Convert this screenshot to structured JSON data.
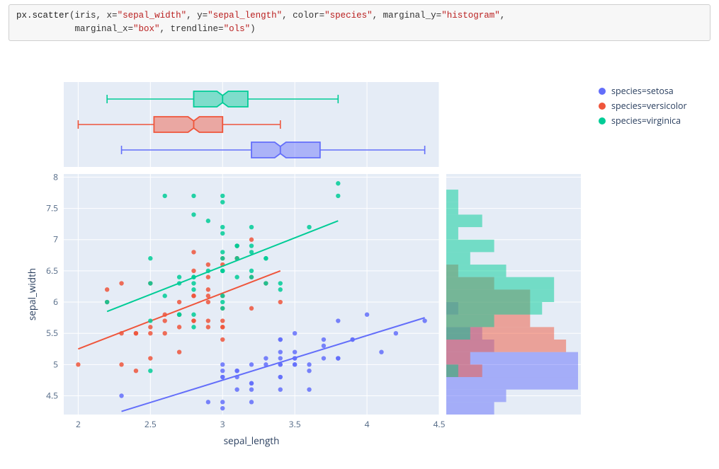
{
  "code_cell": {
    "tokens": [
      {
        "t": "px",
        "cls": "code-var"
      },
      {
        "t": ".",
        "cls": ""
      },
      {
        "t": "scatter",
        "cls": "code-fn"
      },
      {
        "t": "(iris, x=",
        "cls": ""
      },
      {
        "t": "\"sepal_width\"",
        "cls": "code-str"
      },
      {
        "t": ", y=",
        "cls": ""
      },
      {
        "t": "\"sepal_length\"",
        "cls": "code-str"
      },
      {
        "t": ", color=",
        "cls": ""
      },
      {
        "t": "\"species\"",
        "cls": "code-str"
      },
      {
        "t": ", marginal_y=",
        "cls": ""
      },
      {
        "t": "\"histogram\"",
        "cls": "code-str"
      },
      {
        "t": ",",
        "cls": ""
      },
      {
        "t": "\n           marginal_x=",
        "cls": ""
      },
      {
        "t": "\"box\"",
        "cls": "code-str"
      },
      {
        "t": ", trendline=",
        "cls": ""
      },
      {
        "t": "\"ols\"",
        "cls": "code-str"
      },
      {
        "t": ")",
        "cls": ""
      }
    ]
  },
  "legend": {
    "items": [
      {
        "label": "species=setosa",
        "color": "#636efa"
      },
      {
        "label": "species=versicolor",
        "color": "#ef553b"
      },
      {
        "label": "species=virginica",
        "color": "#00cc96"
      }
    ]
  },
  "axes": {
    "x_title": "sepal_length",
    "y_title": "sepal_width",
    "x_ticks": [
      2,
      2.5,
      3,
      3.5,
      4,
      4.5
    ],
    "y_ticks": [
      4.5,
      5,
      5.5,
      6,
      6.5,
      7,
      7.5,
      8
    ],
    "x_range": [
      1.9,
      4.5
    ],
    "y_range": [
      4.2,
      8.05
    ]
  },
  "colors": {
    "setosa": "#636efa",
    "versicolor": "#ef553b",
    "virginica": "#00cc96"
  },
  "chart_data": {
    "type": "scatter",
    "title": "",
    "xlabel": "sepal_length",
    "ylabel": "sepal_width",
    "xlim": [
      1.9,
      4.5
    ],
    "ylim": [
      4.2,
      8.05
    ],
    "marginal_x": "box",
    "marginal_y": "histogram",
    "series": [
      {
        "name": "setosa",
        "color": "#636efa",
        "points": [
          [
            3.5,
            5.1
          ],
          [
            3.0,
            4.9
          ],
          [
            3.2,
            4.7
          ],
          [
            3.1,
            4.6
          ],
          [
            3.6,
            5.0
          ],
          [
            3.9,
            5.4
          ],
          [
            3.4,
            4.6
          ],
          [
            3.4,
            5.0
          ],
          [
            2.9,
            4.4
          ],
          [
            3.1,
            4.9
          ],
          [
            3.7,
            5.4
          ],
          [
            3.4,
            4.8
          ],
          [
            3.0,
            4.8
          ],
          [
            3.0,
            4.3
          ],
          [
            4.0,
            5.8
          ],
          [
            4.4,
            5.7
          ],
          [
            3.9,
            5.4
          ],
          [
            3.5,
            5.1
          ],
          [
            3.8,
            5.7
          ],
          [
            3.8,
            5.1
          ],
          [
            3.4,
            5.4
          ],
          [
            3.7,
            5.1
          ],
          [
            3.6,
            4.6
          ],
          [
            3.3,
            5.1
          ],
          [
            3.4,
            4.8
          ],
          [
            3.0,
            5.0
          ],
          [
            3.4,
            5.0
          ],
          [
            3.5,
            5.2
          ],
          [
            3.4,
            5.2
          ],
          [
            3.2,
            4.7
          ],
          [
            3.1,
            4.8
          ],
          [
            3.4,
            5.4
          ],
          [
            4.1,
            5.2
          ],
          [
            4.2,
            5.5
          ],
          [
            3.1,
            4.9
          ],
          [
            3.2,
            5.0
          ],
          [
            3.5,
            5.5
          ],
          [
            3.6,
            4.9
          ],
          [
            3.0,
            4.4
          ],
          [
            3.4,
            5.1
          ],
          [
            3.5,
            5.0
          ],
          [
            2.3,
            4.5
          ],
          [
            3.2,
            4.4
          ],
          [
            3.5,
            5.0
          ],
          [
            3.8,
            5.1
          ],
          [
            3.0,
            4.8
          ],
          [
            3.8,
            5.1
          ],
          [
            3.2,
            4.6
          ],
          [
            3.7,
            5.3
          ],
          [
            3.3,
            5.0
          ]
        ],
        "trendline": {
          "x1": 2.3,
          "y1": 4.25,
          "x2": 4.4,
          "y2": 5.75
        },
        "box": {
          "min": 2.3,
          "q1": 3.2,
          "median": 3.4,
          "q3": 3.675,
          "max": 4.4
        },
        "hist_bins": {
          "start": 4.2,
          "size": 0.2,
          "counts": [
            4,
            5,
            11,
            11,
            11,
            4,
            3,
            0,
            1
          ]
        }
      },
      {
        "name": "versicolor",
        "color": "#ef553b",
        "points": [
          [
            3.2,
            7.0
          ],
          [
            3.2,
            6.4
          ],
          [
            3.1,
            6.9
          ],
          [
            2.3,
            5.5
          ],
          [
            2.8,
            6.5
          ],
          [
            2.8,
            5.7
          ],
          [
            3.3,
            6.3
          ],
          [
            2.4,
            4.9
          ],
          [
            2.9,
            6.6
          ],
          [
            2.7,
            5.2
          ],
          [
            2.0,
            5.0
          ],
          [
            3.0,
            5.9
          ],
          [
            2.2,
            6.0
          ],
          [
            2.9,
            6.1
          ],
          [
            2.9,
            5.6
          ],
          [
            3.1,
            6.7
          ],
          [
            3.0,
            5.6
          ],
          [
            2.7,
            5.8
          ],
          [
            2.2,
            6.2
          ],
          [
            2.5,
            5.6
          ],
          [
            3.2,
            5.9
          ],
          [
            2.8,
            6.1
          ],
          [
            2.5,
            6.3
          ],
          [
            2.8,
            6.1
          ],
          [
            2.9,
            6.4
          ],
          [
            3.0,
            6.6
          ],
          [
            2.8,
            6.8
          ],
          [
            3.0,
            6.7
          ],
          [
            2.9,
            6.0
          ],
          [
            2.6,
            5.7
          ],
          [
            2.4,
            5.5
          ],
          [
            2.4,
            5.5
          ],
          [
            2.7,
            5.8
          ],
          [
            2.7,
            6.0
          ],
          [
            3.0,
            5.4
          ],
          [
            3.4,
            6.0
          ],
          [
            3.1,
            6.7
          ],
          [
            2.3,
            6.3
          ],
          [
            3.0,
            5.6
          ],
          [
            2.5,
            5.5
          ],
          [
            2.6,
            5.5
          ],
          [
            3.0,
            6.1
          ],
          [
            2.6,
            5.8
          ],
          [
            2.3,
            5.0
          ],
          [
            2.7,
            5.6
          ],
          [
            3.0,
            5.7
          ],
          [
            2.9,
            5.7
          ],
          [
            2.9,
            6.2
          ],
          [
            2.5,
            5.1
          ],
          [
            2.8,
            5.7
          ]
        ],
        "trendline": {
          "x1": 2.0,
          "y1": 5.25,
          "x2": 3.4,
          "y2": 6.5
        },
        "box": {
          "min": 2.0,
          "q1": 2.525,
          "median": 2.8,
          "q3": 3.0,
          "max": 3.4
        },
        "hist_bins": {
          "start": 4.8,
          "size": 0.2,
          "counts": [
            3,
            2,
            10,
            9,
            7,
            7,
            7,
            4,
            1
          ]
        }
      },
      {
        "name": "virginica",
        "color": "#00cc96",
        "points": [
          [
            3.3,
            6.3
          ],
          [
            2.7,
            5.8
          ],
          [
            3.0,
            7.1
          ],
          [
            2.9,
            6.5
          ],
          [
            3.0,
            6.5
          ],
          [
            3.0,
            7.6
          ],
          [
            2.5,
            4.9
          ],
          [
            2.9,
            7.3
          ],
          [
            2.5,
            6.7
          ],
          [
            3.6,
            7.2
          ],
          [
            3.2,
            6.5
          ],
          [
            2.7,
            6.4
          ],
          [
            3.0,
            6.8
          ],
          [
            2.5,
            5.7
          ],
          [
            2.8,
            5.8
          ],
          [
            3.2,
            6.4
          ],
          [
            3.0,
            6.5
          ],
          [
            3.8,
            7.7
          ],
          [
            2.6,
            7.7
          ],
          [
            2.2,
            6.0
          ],
          [
            3.2,
            6.9
          ],
          [
            2.8,
            5.6
          ],
          [
            2.8,
            7.7
          ],
          [
            2.7,
            6.3
          ],
          [
            3.3,
            6.7
          ],
          [
            3.2,
            7.2
          ],
          [
            2.8,
            6.2
          ],
          [
            3.0,
            6.1
          ],
          [
            2.8,
            6.4
          ],
          [
            3.0,
            7.2
          ],
          [
            2.8,
            7.4
          ],
          [
            3.8,
            7.9
          ],
          [
            2.8,
            6.4
          ],
          [
            2.8,
            6.3
          ],
          [
            2.6,
            6.1
          ],
          [
            3.0,
            7.7
          ],
          [
            3.4,
            6.3
          ],
          [
            3.1,
            6.4
          ],
          [
            3.0,
            6.0
          ],
          [
            3.1,
            6.9
          ],
          [
            3.1,
            6.7
          ],
          [
            3.1,
            6.9
          ],
          [
            2.7,
            5.8
          ],
          [
            3.2,
            6.8
          ],
          [
            3.3,
            6.7
          ],
          [
            3.0,
            6.7
          ],
          [
            2.5,
            6.3
          ],
          [
            3.0,
            6.5
          ],
          [
            3.4,
            6.2
          ],
          [
            3.0,
            5.9
          ]
        ],
        "trendline": {
          "x1": 2.2,
          "y1": 5.85,
          "x2": 3.8,
          "y2": 7.3
        },
        "box": {
          "min": 2.2,
          "q1": 2.8,
          "median": 3.0,
          "q3": 3.175,
          "max": 3.8
        },
        "hist_bins": {
          "start": 4.8,
          "size": 0.2,
          "counts": [
            1,
            0,
            0,
            2,
            4,
            8,
            9,
            9,
            5,
            2,
            4,
            1,
            3,
            1,
            1
          ]
        }
      }
    ]
  }
}
